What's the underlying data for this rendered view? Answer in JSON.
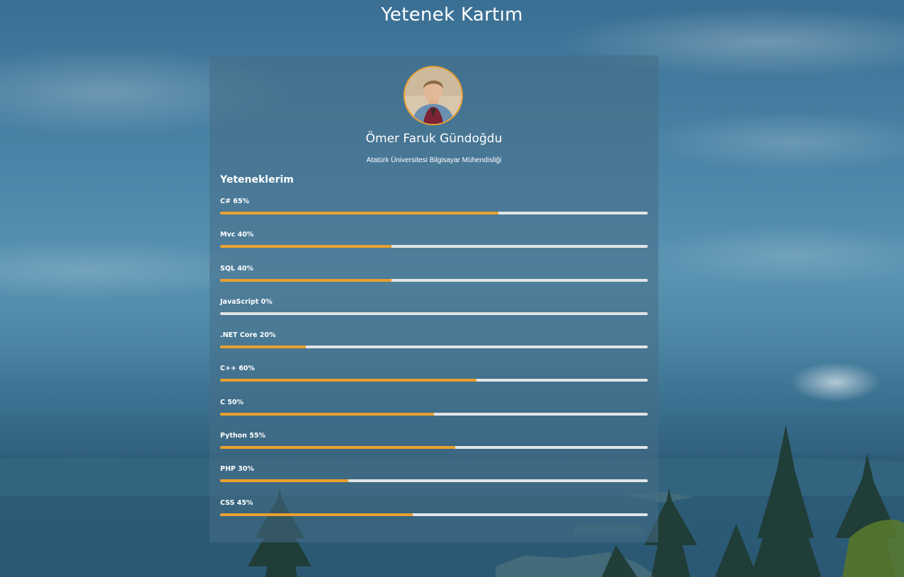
{
  "page": {
    "title": "Yetenek Kartım"
  },
  "profile": {
    "name": "Ömer Faruk Gündoğdu",
    "school": "Atatürk Üniversitesi Bilgisayar Mühendisliği"
  },
  "skills_section": {
    "title": "Yeteneklerim"
  },
  "skills": [
    {
      "name": "C#",
      "percent": 65,
      "label": "C# 65%"
    },
    {
      "name": "Mvc",
      "percent": 40,
      "label": "Mvc 40%"
    },
    {
      "name": "SQL",
      "percent": 40,
      "label": "SQL 40%"
    },
    {
      "name": "JavaScript",
      "percent": 0,
      "label": "JavaScript 0%"
    },
    {
      "name": ".NET Core",
      "percent": 20,
      "label": ".NET Core 20%"
    },
    {
      "name": "C++",
      "percent": 60,
      "label": "C++ 60%"
    },
    {
      "name": "C",
      "percent": 50,
      "label": "C 50%"
    },
    {
      "name": "Python",
      "percent": 55,
      "label": "Python 55%"
    },
    {
      "name": "PHP",
      "percent": 30,
      "label": "PHP 30%"
    },
    {
      "name": "CSS",
      "percent": 45,
      "label": "CSS 45%"
    }
  ],
  "colors": {
    "accent": "#e9a02e",
    "track": "#e1e4e6",
    "card": "#466e87"
  }
}
